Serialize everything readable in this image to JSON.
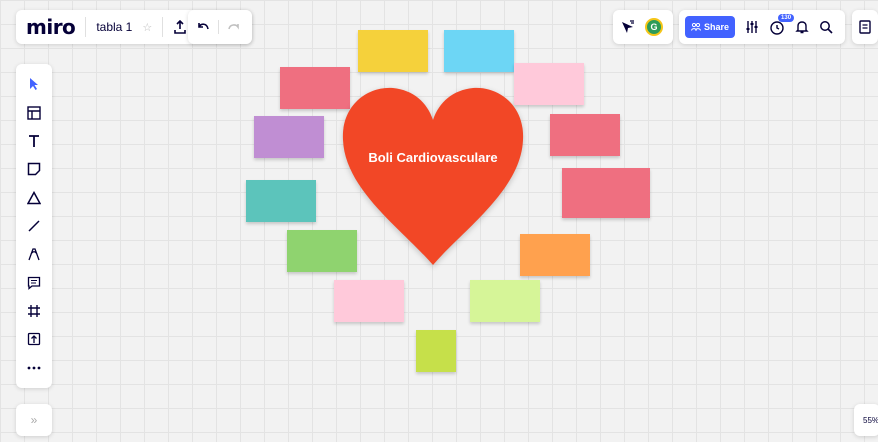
{
  "app": {
    "logo": "miro",
    "board_name": "tabla 1"
  },
  "header": {
    "share_label": "Share",
    "avatar_initial": "G",
    "notification_count": "130"
  },
  "canvas": {
    "heart_label": "Boli Cardiovasculare",
    "sticky_note_colors": [
      "#f5d13b",
      "#6dd6f5",
      "#ef6f80",
      "#ffc9da",
      "#c08ed3",
      "#ef6f80",
      "#5cc4bb",
      "#8fd36f",
      "#ffa14e",
      "#ffc9da",
      "#d6f598",
      "#c6e04a"
    ]
  },
  "footer": {
    "zoom": "55%",
    "expand_label": "»"
  },
  "colors": {
    "heart": "#f24726",
    "accent": "#4262ff",
    "canvas_bg": "#f2f2f2"
  }
}
